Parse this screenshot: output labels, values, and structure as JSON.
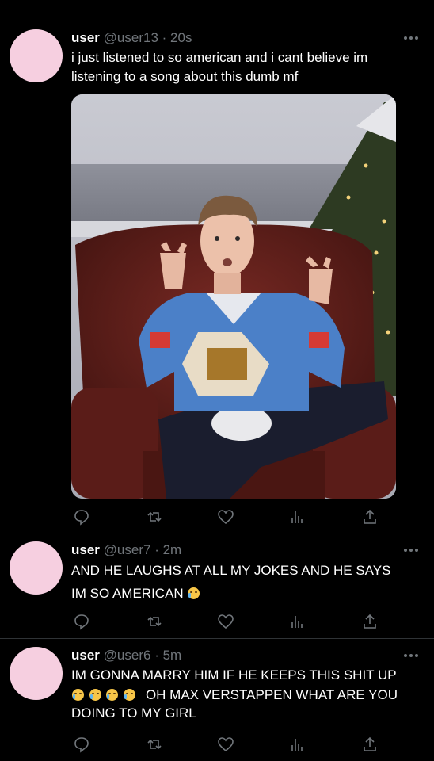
{
  "tweets": [
    {
      "name": "user",
      "handle": "@user13",
      "separator": "·",
      "time": "20s",
      "lines": [
        "i just listened to so american and i cant believe im",
        "listening to a song about this dumb mf"
      ],
      "has_media": true
    },
    {
      "name": "user",
      "handle": "@user7",
      "separator": "·",
      "time": "2m",
      "lines": [
        "AND HE LAUGHS AT ALL MY JOKES AND HE SAYS",
        "IM SO AMERICAN"
      ],
      "has_media": false
    },
    {
      "name": "user",
      "handle": "@user6",
      "separator": "·",
      "time": "5m",
      "lines": [
        "IM GONNA MARRY HIM IF HE KEEPS THIS SHIT UP",
        "OH MAX VERSTAPPEN WHAT ARE YOU",
        "DOING TO MY GIRL"
      ],
      "has_media": false
    }
  ],
  "icons": {
    "reply": "reply-icon",
    "retweet": "retweet-icon",
    "like": "heart-icon",
    "views": "analytics-icon",
    "share": "share-icon",
    "more": "more-icon",
    "emoji": "loudly-crying-face-emoji"
  },
  "colors": {
    "background": "#000000",
    "text": "#ffffff",
    "muted": "#71767b",
    "avatar": "#f6cfe0",
    "divider": "#2f3336"
  }
}
